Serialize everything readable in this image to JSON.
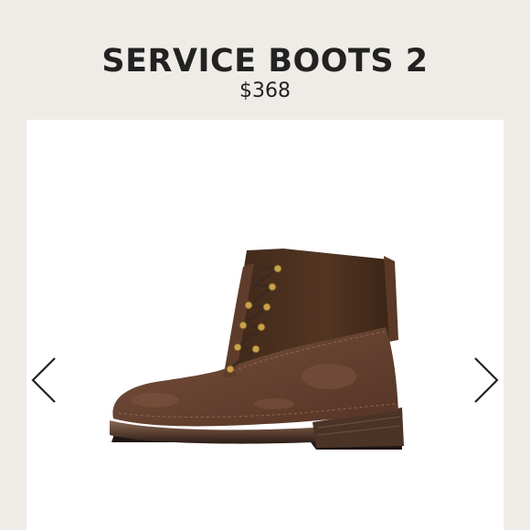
{
  "product": {
    "title": "SERVICE BOOTS 2",
    "price": "$368"
  },
  "gallery": {
    "prev_icon": "chevron-left-icon",
    "next_icon": "chevron-right-icon",
    "image": "boot-image"
  },
  "colors": {
    "page_background": "#efece8",
    "card_background": "#ffffff",
    "text": "#222222",
    "suede": "#6b4330",
    "leather": "#4a2f1e",
    "sole": "#2a1d16"
  }
}
